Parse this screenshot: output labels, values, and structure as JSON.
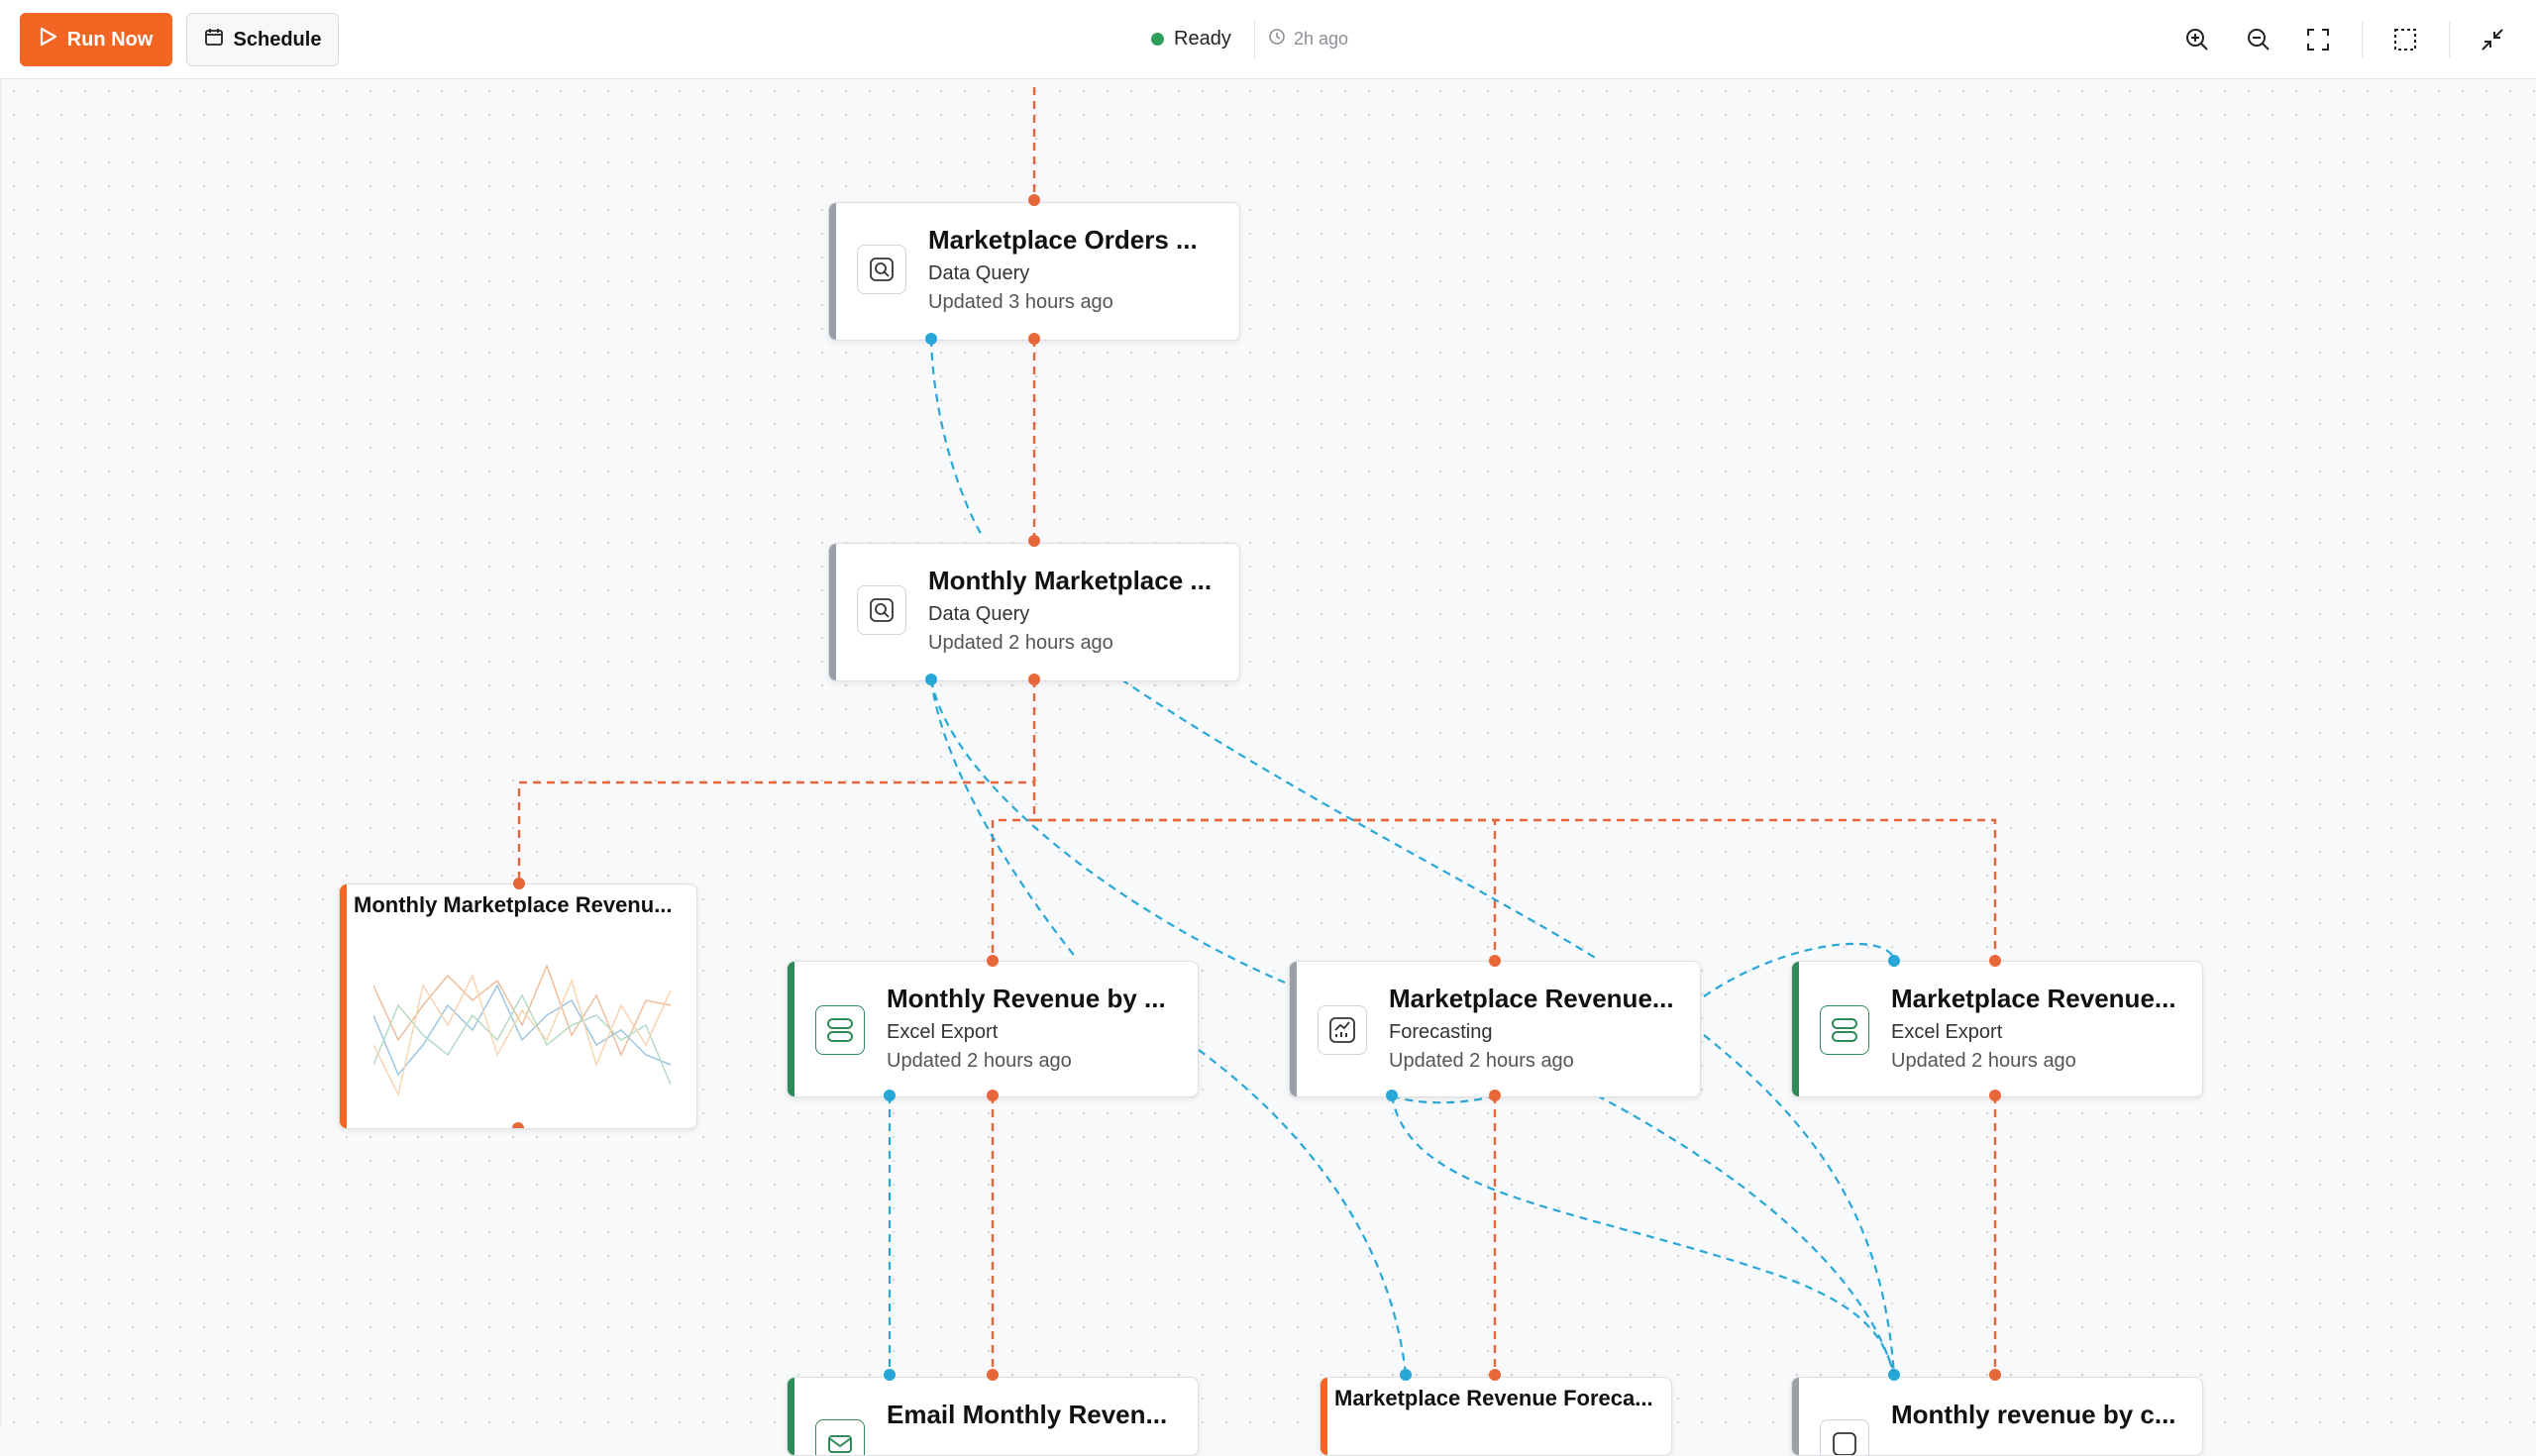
{
  "toolbar": {
    "run_label": "Run Now",
    "schedule_label": "Schedule",
    "status_text": "Ready",
    "last_run": "2h ago",
    "tools": [
      "zoom-in-icon",
      "zoom-out-icon",
      "fit-view-icon",
      "select-area-icon",
      "collapse-icon"
    ]
  },
  "colors": {
    "accent": "#f26522",
    "status_ready": "#2e9e5b",
    "flow_edge": "#e8673a",
    "data_edge": "#27a7d8",
    "export_bar": "#2e8b57",
    "query_bar": "#9aa0a6"
  },
  "nodes": {
    "orders": {
      "title": "Marketplace Orders ...",
      "type": "Data Query",
      "updated": "Updated 3 hours ago"
    },
    "monthly": {
      "title": "Monthly Marketplace ...",
      "type": "Data Query",
      "updated": "Updated 2 hours ago"
    },
    "chart1": {
      "title": "Monthly Marketplace Revenu..."
    },
    "export1": {
      "title": "Monthly Revenue by ...",
      "type": "Excel Export",
      "updated": "Updated 2 hours ago"
    },
    "forecast": {
      "title": "Marketplace Revenue...",
      "type": "Forecasting",
      "updated": "Updated 2 hours ago"
    },
    "export2": {
      "title": "Marketplace Revenue...",
      "type": "Excel Export",
      "updated": "Updated 2 hours ago"
    },
    "email": {
      "title": "Email Monthly Reven..."
    },
    "chart2": {
      "title": "Marketplace Revenue Foreca..."
    },
    "monthly_cat": {
      "title": "Monthly revenue by c..."
    }
  }
}
